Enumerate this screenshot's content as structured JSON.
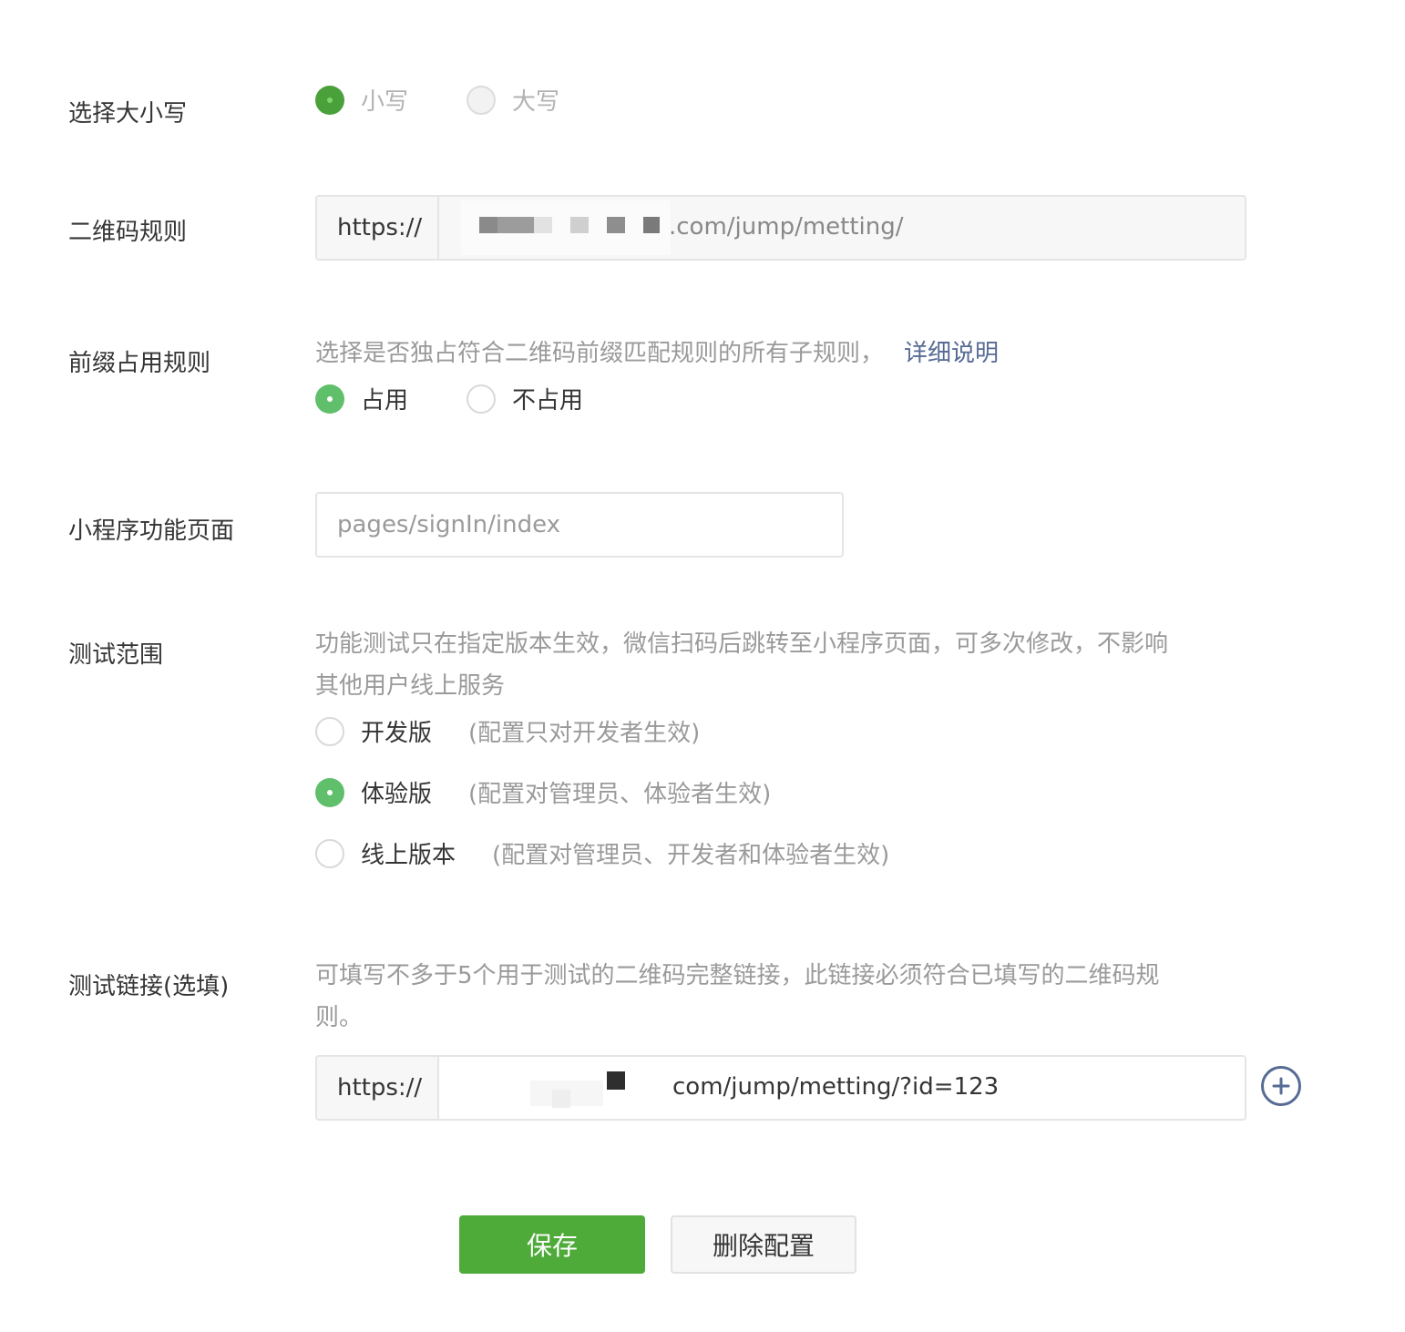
{
  "case_row": {
    "label": "选择大小写",
    "options": [
      {
        "label": "小写",
        "checked": true
      },
      {
        "label": "大写",
        "checked": false
      }
    ]
  },
  "qr_rule": {
    "label": "二维码规则",
    "prefix": "https://",
    "value_visible": ".com/jump/metting/"
  },
  "prefix_rule": {
    "label": "前缀占用规则",
    "description": "选择是否独占符合二维码前缀匹配规则的所有子规则，",
    "link": "详细说明",
    "options": [
      {
        "label": "占用",
        "checked": true
      },
      {
        "label": "不占用",
        "checked": false
      }
    ]
  },
  "page": {
    "label": "小程序功能页面",
    "value": "pages/signIn/index"
  },
  "test_scope": {
    "label": "测试范围",
    "description_line1": "功能测试只在指定版本生效，微信扫码后跳转至小程序页面，可多次修改，不影响",
    "description_line2": "其他用户线上服务",
    "options": [
      {
        "label": "开发版",
        "note": "(配置只对开发者生效)",
        "checked": false
      },
      {
        "label": "体验版",
        "note": "(配置对管理员、体验者生效)",
        "checked": true
      },
      {
        "label": "线上版本",
        "note": "(配置对管理员、开发者和体验者生效)",
        "checked": false
      }
    ]
  },
  "test_link": {
    "label": "测试链接(选填)",
    "description_line1": "可填写不多于5个用于测试的二维码完整链接，此链接必须符合已填写的二维码规",
    "description_line2": "则。",
    "prefix": "https://",
    "value_visible": "com/jump/metting/?id=123"
  },
  "actions": {
    "save": "保存",
    "delete": "删除配置"
  },
  "colors": {
    "primary": "#4eaa39",
    "radio_checked": "#5fbf6a",
    "link": "#576b95"
  }
}
